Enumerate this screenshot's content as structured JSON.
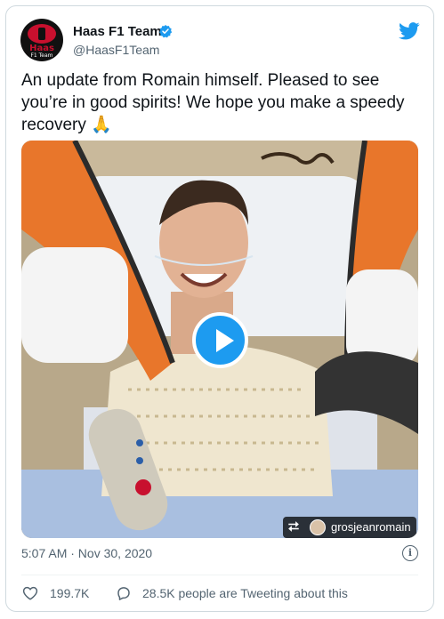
{
  "account": {
    "name": "Haas F1 Team",
    "handle": "@HaasF1Team",
    "avatar_text_top": "Haas",
    "avatar_text_bottom": "F1 Team",
    "verified_icon": "verified-badge-icon",
    "brand_color": "#1d9bf0"
  },
  "tweet": {
    "text": "An update from Romain himself. Pleased to see you’re in good spirits! We hope you make a speedy recovery 🙏"
  },
  "media": {
    "type": "video",
    "play_icon": "play-icon",
    "repost_icon": "⮂",
    "repost_user": "grosjeanromain"
  },
  "meta": {
    "timestamp": "5:07 AM · Nov 30, 2020",
    "info_icon": "i"
  },
  "actions": {
    "likes": "199.7K",
    "replies_text": "28.5K people are Tweeting about this"
  }
}
